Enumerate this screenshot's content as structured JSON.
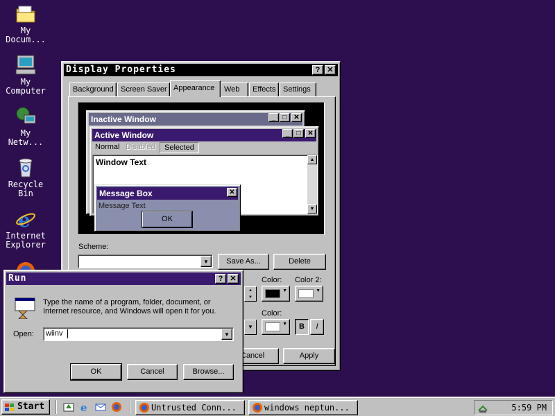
{
  "desktop": {
    "icons": [
      {
        "label1": "My",
        "label2": "Docum..."
      },
      {
        "label1": "My",
        "label2": "Computer"
      },
      {
        "label1": "My",
        "label2": "Netw..."
      },
      {
        "label1": "Recycle",
        "label2": "Bin"
      },
      {
        "label1": "Internet",
        "label2": "Explorer"
      }
    ]
  },
  "display": {
    "title": "Display Properties",
    "help_btn": "?",
    "close_btn": "✕",
    "tabs": [
      "Background",
      "Screen Saver",
      "Appearance",
      "Web",
      "Effects",
      "Settings"
    ],
    "active_tab": "Appearance",
    "preview": {
      "inactive_title": "Inactive Window",
      "active_title": "Active Window",
      "menu": [
        "Normal",
        "Disabled",
        "Selected"
      ],
      "window_text": "Window Text",
      "msgbox_title": "Message Box",
      "msgbox_text": "Message Text",
      "msgbox_ok": "OK"
    },
    "scheme_label": "Scheme:",
    "scheme_value": "",
    "save_as": "Save As...",
    "delete": "Delete",
    "color_label": "Color:",
    "color2_label": "Color 2:",
    "color_label2": "Color:",
    "bold": "B",
    "italic": "I",
    "cancel": "Cancel",
    "apply": "Apply"
  },
  "run": {
    "title": "Run",
    "help_btn": "?",
    "close_btn": "✕",
    "description": "Type the name of a program, folder, document, or Internet resource, and Windows will open it for you.",
    "open_label": "Open:",
    "open_value": "wiinv",
    "ok": "OK",
    "cancel": "Cancel",
    "browse": "Browse..."
  },
  "taskbar": {
    "start": "Start",
    "tasks": [
      "Untrusted Conn...",
      "windows neptun..."
    ],
    "clock": "5:59 PM"
  },
  "colors": {
    "desktop": "#2d0f4f",
    "active_title": "#3a1a6e",
    "inactive_title": "#6a6a8a",
    "msgbox_bg": "#8a8fad"
  }
}
